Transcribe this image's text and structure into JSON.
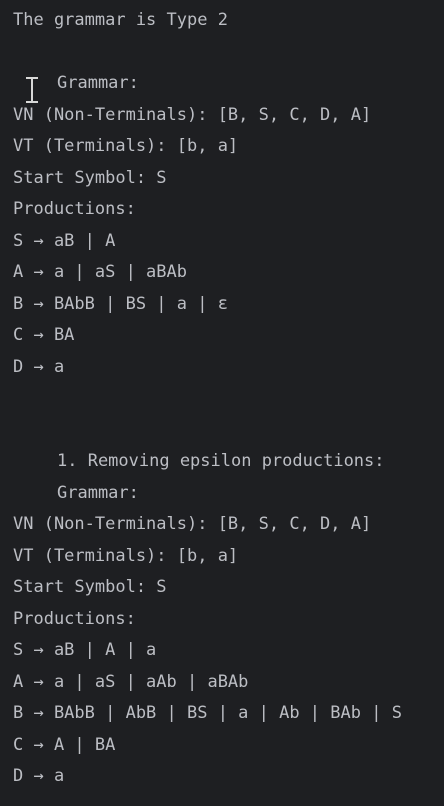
{
  "console": {
    "grammar_type": "The grammar is Type 2",
    "original": {
      "header": "Grammar:",
      "vn": "VN (Non-Terminals): [B, S, C, D, A]",
      "vt": "VT (Terminals): [b, a]",
      "start": "Start Symbol: S",
      "productions_label": "Productions:",
      "productions": [
        "S → aB | A",
        "A → a | aS | aBAb",
        "B → BAbB | BS | a | ε",
        "C → BA",
        "D → a"
      ]
    },
    "step1": {
      "title": "1. Removing epsilon productions:",
      "header": "Grammar:",
      "vn": "VN (Non-Terminals): [B, S, C, D, A]",
      "vt": "VT (Terminals): [b, a]",
      "start": "Start Symbol: S",
      "productions_label": "Productions:",
      "productions": [
        "S → aB | A | a",
        "A → a | aS | aAb | aBAb",
        "B → BAbB | AbB | BS | a | Ab | BAb | S",
        "C → A | BA",
        "D → a"
      ]
    }
  }
}
